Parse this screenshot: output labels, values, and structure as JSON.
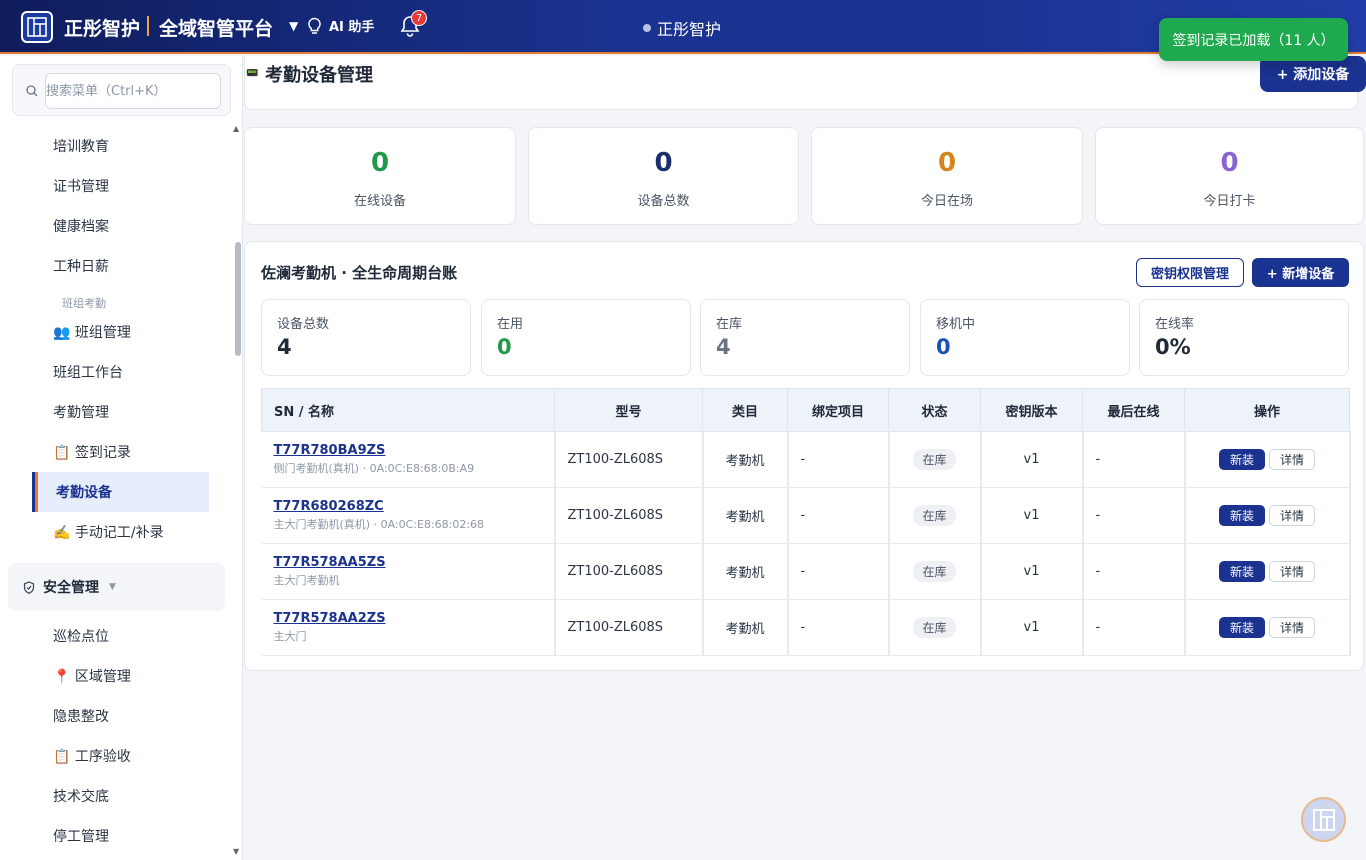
{
  "header": {
    "brand": "正彤智护",
    "platform": "全域智管平台",
    "ai_label": "AI 助手",
    "notification_count": "7",
    "center_title": "正彤智护"
  },
  "toast": {
    "text": "签到记录已加载（11 人）"
  },
  "sidebar": {
    "search_placeholder": "搜索菜单（Ctrl+K）",
    "items": [
      {
        "label": "培训教育"
      },
      {
        "label": "证书管理"
      },
      {
        "label": "健康档案"
      },
      {
        "label": "工种日薪"
      },
      {
        "label": "班组考勤"
      },
      {
        "label": "👥 班组管理"
      },
      {
        "label": "班组工作台"
      },
      {
        "label": "考勤管理"
      },
      {
        "label": "📋 签到记录"
      },
      {
        "label": "考勤设备"
      },
      {
        "label": "✍️ 手动记工/补录"
      },
      {
        "label": "安全管理"
      },
      {
        "label": "巡检点位"
      },
      {
        "label": "📍 区域管理"
      },
      {
        "label": "隐患整改"
      },
      {
        "label": "📋 工序验收"
      },
      {
        "label": "技术交底"
      },
      {
        "label": "停工管理"
      }
    ]
  },
  "page": {
    "title": "考勤设备管理",
    "add_button": "+ 添加设备"
  },
  "stats": [
    {
      "value": "0",
      "label": "在线设备",
      "color": "#1e9a4a"
    },
    {
      "value": "0",
      "label": "设备总数",
      "color": "#1a2f6e"
    },
    {
      "value": "0",
      "label": "今日在场",
      "color": "#d4861c"
    },
    {
      "value": "0",
      "label": "今日打卡",
      "color": "#8a63d2"
    }
  ],
  "panel": {
    "title": "佐澜考勤机 · 全生命周期台账",
    "key_button": "密钥权限管理",
    "new_button": "+ 新增设备",
    "summary": [
      {
        "label": "设备总数",
        "value": "4",
        "color": "#1f2937"
      },
      {
        "label": "在用",
        "value": "0",
        "color": "#1e9a4a"
      },
      {
        "label": "在库",
        "value": "4",
        "color": "#6b7280"
      },
      {
        "label": "移机中",
        "value": "0",
        "color": "#1d4fb8"
      },
      {
        "label": "在线率",
        "value": "0%",
        "color": "#1f2937"
      }
    ],
    "columns": [
      "SN / 名称",
      "型号",
      "类目",
      "绑定项目",
      "状态",
      "密钥版本",
      "最后在线",
      "操作"
    ],
    "rows": [
      {
        "sn": "T77R780BA9ZS",
        "sub": "侧门考勤机(真机) · 0A:0C:E8:68:0B:A9",
        "model": "ZT100-ZL608S",
        "category": "考勤机",
        "project": "-",
        "status": "在库",
        "key": "v1",
        "last": "-",
        "op1": "新装",
        "op2": "详情"
      },
      {
        "sn": "T77R680268ZC",
        "sub": "主大门考勤机(真机) · 0A:0C:E8:68:02:68",
        "model": "ZT100-ZL608S",
        "category": "考勤机",
        "project": "-",
        "status": "在库",
        "key": "v1",
        "last": "-",
        "op1": "新装",
        "op2": "详情"
      },
      {
        "sn": "T77R578AA5ZS",
        "sub": "主大门考勤机",
        "model": "ZT100-ZL608S",
        "category": "考勤机",
        "project": "-",
        "status": "在库",
        "key": "v1",
        "last": "-",
        "op1": "新装",
        "op2": "详情"
      },
      {
        "sn": "T77R578AA2ZS",
        "sub": "主大门",
        "model": "ZT100-ZL608S",
        "category": "考勤机",
        "project": "-",
        "status": "在库",
        "key": "v1",
        "last": "-",
        "op1": "新装",
        "op2": "详情"
      }
    ]
  }
}
